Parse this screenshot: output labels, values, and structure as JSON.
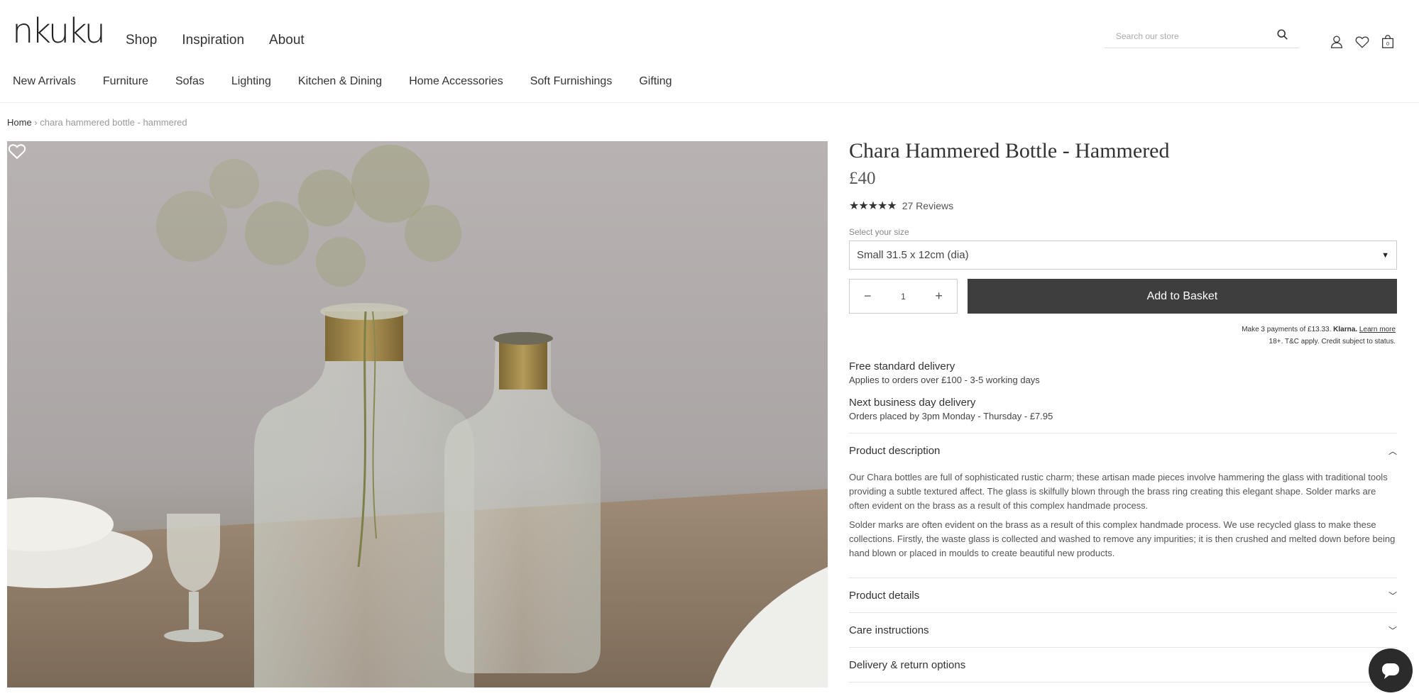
{
  "header": {
    "logo": "nkuku",
    "main_nav": [
      "Shop",
      "Inspiration",
      "About"
    ],
    "search_placeholder": "Search our store",
    "categories": [
      "New Arrivals",
      "Furniture",
      "Sofas",
      "Lighting",
      "Kitchen & Dining",
      "Home Accessories",
      "Soft Furnishings",
      "Gifting"
    ],
    "basket_count": "0"
  },
  "breadcrumb": {
    "home": "Home",
    "separator": " › ",
    "current": "chara hammered bottle - hammered"
  },
  "product": {
    "title": "Chara Hammered Bottle - Hammered",
    "price": "£40",
    "stars": "★★★★★",
    "rating_out_of_5": 5,
    "reviews": "27 Reviews",
    "size_label": "Select your size",
    "size_selected": "Small 31.5 x 12cm (dia)",
    "quantity": "1",
    "add_to_basket": "Add to Basket",
    "klarna_text": "Make 3 payments of £13.33.",
    "klarna_brand": "Klarna.",
    "klarna_link": "Learn more",
    "klarna_terms": "18+. T&C apply. Credit subject to status."
  },
  "delivery": [
    {
      "title": "Free standard delivery",
      "sub": "Applies to orders over £100 - 3-5 working days"
    },
    {
      "title": "Next business day delivery",
      "sub": "Orders placed by 3pm Monday - Thursday - £7.95"
    }
  ],
  "accordion": {
    "description_title": "Product description",
    "description_p1": "Our Chara bottles are full of sophisticated rustic charm; these artisan made pieces involve hammering the glass with traditional tools providing a subtle textured affect. The glass is skilfully blown through the brass ring creating this elegant shape. Solder marks are often evident on the brass as a result of this complex handmade process.",
    "description_p2": "Solder marks are often evident on the brass as a result of this complex handmade process. We use recycled glass to make these collections. Firstly, the waste glass is collected and washed to remove any impurities; it is then crushed and melted down before being hand blown or placed in moulds to create beautiful new products.",
    "details_title": "Product details",
    "care_title": "Care instructions",
    "returns_title": "Delivery & return options"
  },
  "colors": {
    "button_dark": "#3e3e3e",
    "brass": "#a8904e"
  }
}
